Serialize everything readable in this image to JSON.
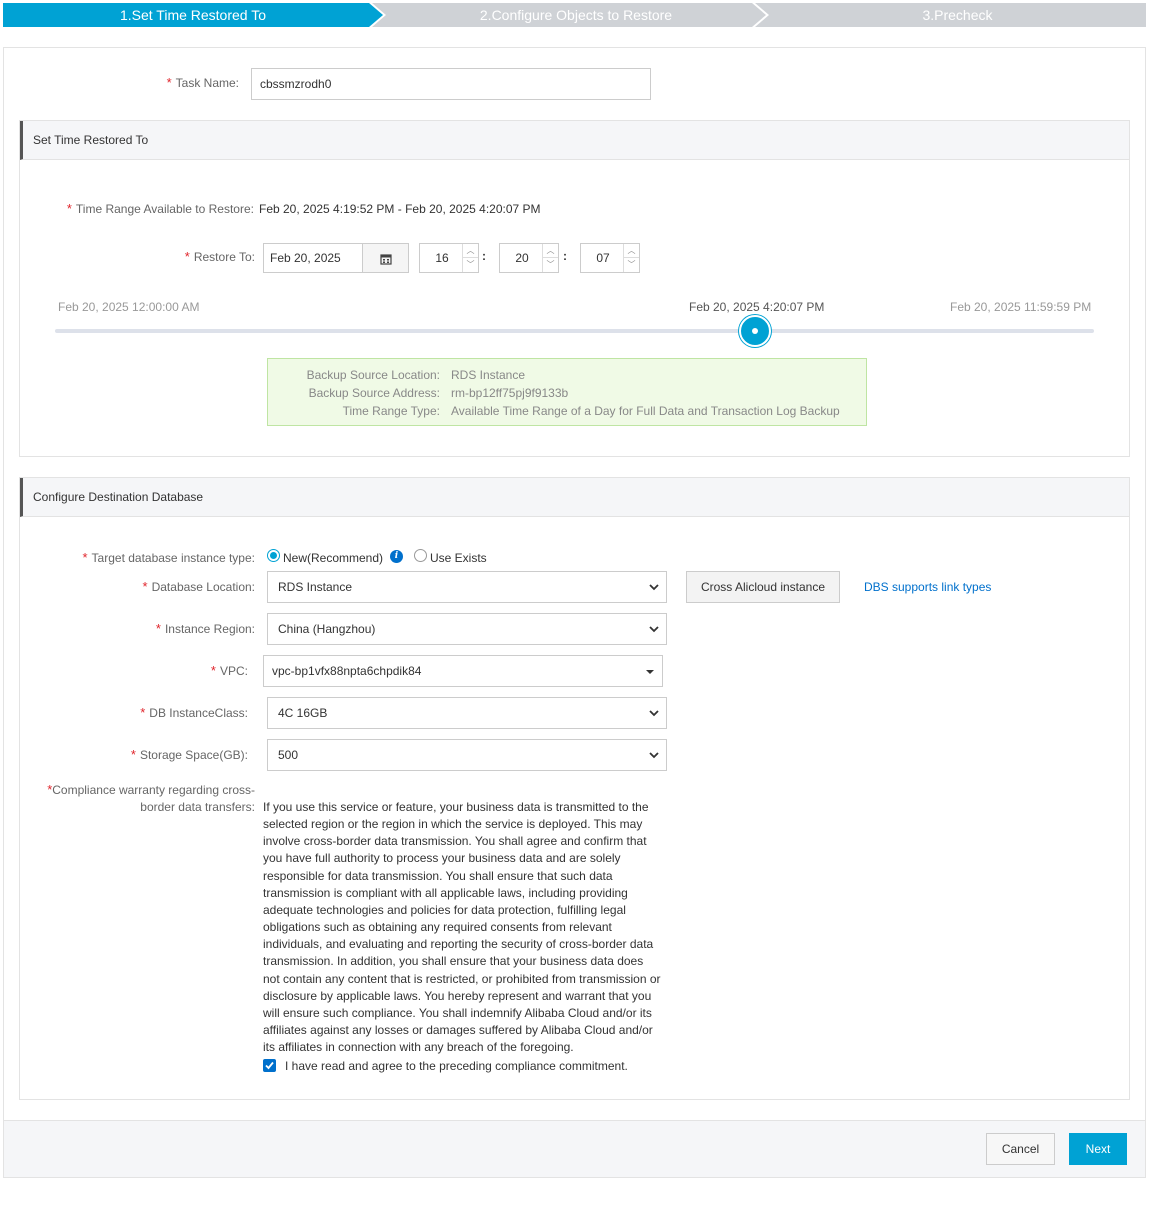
{
  "steps": [
    {
      "label": "1.Set Time Restored To",
      "active": true
    },
    {
      "label": "2.Configure Objects to Restore",
      "active": false
    },
    {
      "label": "3.Precheck",
      "active": false
    }
  ],
  "task": {
    "label": "Task Name:",
    "value": "cbssmzrodh0"
  },
  "time_section": {
    "title": "Set Time Restored To",
    "range_label": "Time Range Available to Restore:",
    "range_value": "Feb 20, 2025 4:19:52 PM - Feb 20, 2025 4:20:07 PM",
    "restore_label": "Restore To:",
    "date": "Feb 20, 2025",
    "hour": "16",
    "minute": "20",
    "second": "07",
    "slider_start": "Feb 20, 2025 12:00:00 AM",
    "slider_current": "Feb 20, 2025 4:20:07 PM",
    "slider_end": "Feb 20, 2025 11:59:59 PM",
    "slider_fraction": 0.674,
    "info": [
      {
        "k": "Backup Source Location:",
        "v": "RDS Instance"
      },
      {
        "k": "Backup Source Address:",
        "v": "rm-bp12ff75pj9f9133b"
      },
      {
        "k": "Time Range Type:",
        "v": "Available Time Range of a Day for Full Data and Transaction Log Backup"
      }
    ]
  },
  "dest_section": {
    "title": "Configure Destination Database",
    "type_label": "Target database instance type:",
    "type_new": "New(Recommend)",
    "type_exists": "Use Exists",
    "location_label": "Database Location:",
    "location_value": "RDS Instance",
    "cross_button": "Cross Alicloud instance",
    "link_types": "DBS supports link types",
    "region_label": "Instance Region:",
    "region_value": "China (Hangzhou)",
    "vpc_label": "VPC:",
    "vpc_value": "vpc-bp1vfx88npta6chpdik84",
    "class_label": "DB InstanceClass:",
    "class_value": "4C 16GB",
    "storage_label": "Storage Space(GB):",
    "storage_value": "500",
    "compliance_label_1": "Compliance warranty regarding cross-",
    "compliance_label_2": "border data transfers:",
    "compliance_text": "If you use this service or feature, your business data is transmitted to the selected region or the region in which the service is deployed. This may involve cross-border data transmission. You shall agree and confirm that you have full authority to process your business data and are solely responsible for data transmission. You shall ensure that such data transmission is compliant with all applicable laws, including providing adequate technologies and policies for data protection, fulfilling legal obligations such as obtaining any required consents from relevant individuals, and evaluating and reporting the security of cross-border data transmission. In addition, you shall ensure that your business data does not contain any content that is restricted, or prohibited from transmission or disclosure by applicable laws. You hereby represent and warrant that you will ensure such compliance. You shall indemnify Alibaba Cloud and/or its affiliates against any losses or damages suffered by Alibaba Cloud and/or its affiliates in connection with any breach of the foregoing.",
    "agree_text": "I have read and agree to the preceding compliance commitment.",
    "agree_checked": true
  },
  "footer": {
    "cancel": "Cancel",
    "next": "Next"
  },
  "colors": {
    "accent": "#00a2d4",
    "step_inactive": "#cfd2d6",
    "link": "#0070cc",
    "required": "#e0242b"
  }
}
